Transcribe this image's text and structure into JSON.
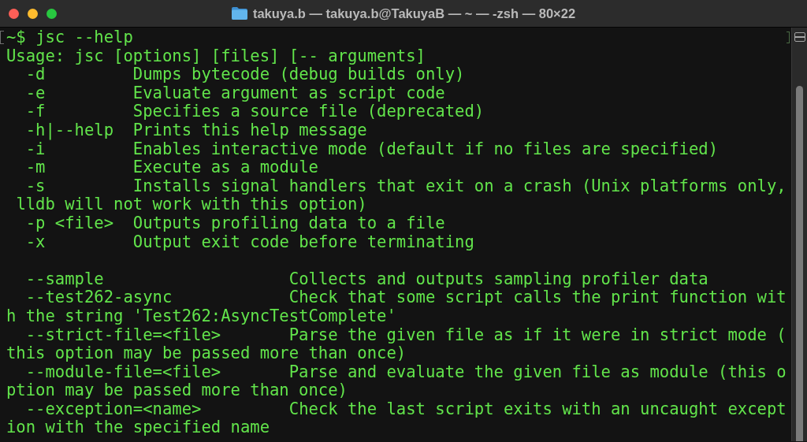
{
  "window": {
    "title": "takuya.b — takuya.b@TakuyaB — ~ — -zsh — 80×22"
  },
  "terminal": {
    "prompt_line": {
      "prompt": "~$",
      "command": "jsc --help",
      "marked": true
    },
    "output_blocks": [
      [
        "Usage: jsc [options] [files] [-- arguments]",
        "  -d         Dumps bytecode (debug builds only)",
        "  -e         Evaluate argument as script code",
        "  -f         Specifies a source file (deprecated)",
        "  -h|--help  Prints this help message",
        "  -i         Enables interactive mode (default if no files are specified)",
        "  -m         Execute as a module",
        "  -s         Installs signal handlers that exit on a crash (Unix platforms only,",
        " lldb will not work with this option)",
        "  -p <file>  Outputs profiling data to a file",
        "  -x         Output exit code before terminating"
      ],
      [
        "  --sample                   Collects and outputs sampling profiler data",
        "  --test262-async            Check that some script calls the print function wit",
        "h the string 'Test262:AsyncTestComplete'",
        "  --strict-file=<file>       Parse the given file as if it were in strict mode (",
        "this option may be passed more than once)",
        "  --module-file=<file>       Parse and evaluate the given file as module (this o",
        "ption may be passed more than once)",
        "  --exception=<name>         Check the last script exits with an uncaught except",
        "ion with the specified name"
      ]
    ]
  }
}
